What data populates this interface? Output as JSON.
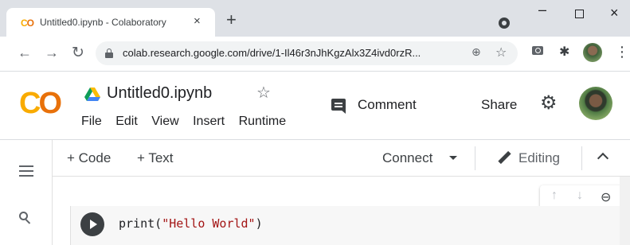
{
  "browser": {
    "tab": {
      "favicon": "colab-logo-icon",
      "title": "Untitled0.ipynb - Colaboratory",
      "close": "×"
    },
    "new_tab": "+",
    "window_controls": {
      "minimize": "–",
      "close": "×"
    },
    "address_bar": {
      "url": "colab.research.google.com/drive/1-Il46r3nJhKgzAlx3Z4ivd0rzR..."
    },
    "icons": [
      "back-arrow-icon",
      "forward-arrow-icon",
      "reload-icon",
      "lock-icon",
      "zoom-icon",
      "bookmark-star-icon",
      "camera-icon",
      "puzzle-icon",
      "avatar",
      "menu-dots-icon"
    ]
  },
  "colab": {
    "logo": "CO",
    "notebook_title": "Untitled0.ipynb",
    "menu": [
      "File",
      "Edit",
      "View",
      "Insert",
      "Runtime"
    ],
    "comment_label": "Comment",
    "share_label": "Share",
    "toolbar": {
      "add_code": "+ Code",
      "add_text": "+ Text",
      "connect": "Connect",
      "editing": "Editing"
    },
    "cell": {
      "code_fn": "print(",
      "code_str": "\"Hello World\"",
      "code_close": ")"
    },
    "colors": {
      "logo_yellow": "#f9ab00",
      "logo_orange": "#e8710a",
      "string_red": "#a31515"
    }
  }
}
